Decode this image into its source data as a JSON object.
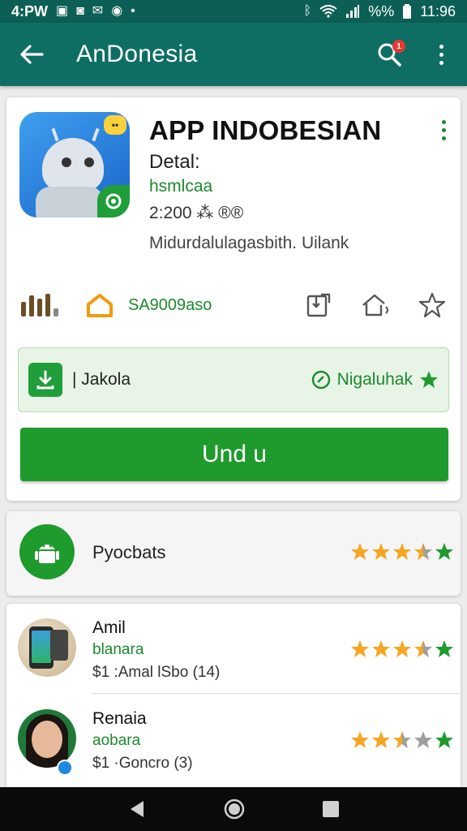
{
  "status_bar": {
    "left_text": "4:PW",
    "time": "11:96",
    "battery": "%%"
  },
  "app_bar": {
    "title": "AnDonesia",
    "search_badge": "1",
    "color": "#0f6e64"
  },
  "app": {
    "title": "APP INDOBESIAN",
    "subtitle": "Detal:",
    "developer": "hsmlcaa",
    "meta": "2:200 ⁂ ®®",
    "description": "Midurdalulagasbith. Uilank",
    "stat_label": "SA9009aso",
    "install_label": "| Jakola",
    "verified_label": "Nigaluhak",
    "primary_button": "Und u"
  },
  "reviews_header": {
    "label": "Pyocbats",
    "rating": 3.5
  },
  "reviews": [
    {
      "name": "Amil",
      "subtitle": "blanara",
      "meta": "$1 :Amal lSbo (14)",
      "rating": 3.5
    },
    {
      "name": "Renaia",
      "subtitle": "aobara",
      "meta": "$1 ·Goncro (3)",
      "rating": 2.5
    }
  ],
  "colors": {
    "accent_green": "#1f9a2d",
    "star_gold": "#f5a623",
    "star_grey": "#9e9e9e"
  }
}
